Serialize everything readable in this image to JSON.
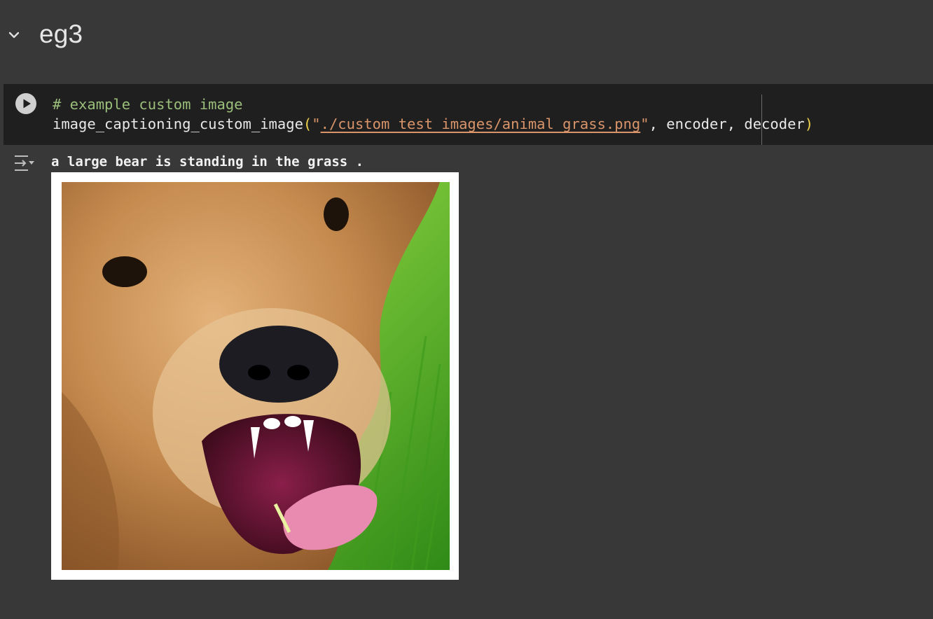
{
  "section": {
    "title": "eg3",
    "collapse_icon": "chevron-down-icon"
  },
  "code_cell": {
    "run_icon": "play-circle-icon",
    "line1_comment": "# example custom image",
    "line2": {
      "func": "image_captioning_custom_image",
      "open_paren": "(",
      "quote_open": "\"",
      "path": "./custom_test_images/animal_grass.png",
      "quote_close": "\"",
      "args": ", encoder, decoder",
      "close_paren": ")"
    }
  },
  "output": {
    "icon": "output-toggle-icon",
    "text": "a large bear is standing in the grass .",
    "image_description": "close-up of a brown furry animal with open mouth in green grass"
  },
  "colors": {
    "background": "#383838",
    "cell_background": "#1f1f1f",
    "comment": "#9bbf7a",
    "string": "#d9946a",
    "paren": "#f1d34a"
  }
}
